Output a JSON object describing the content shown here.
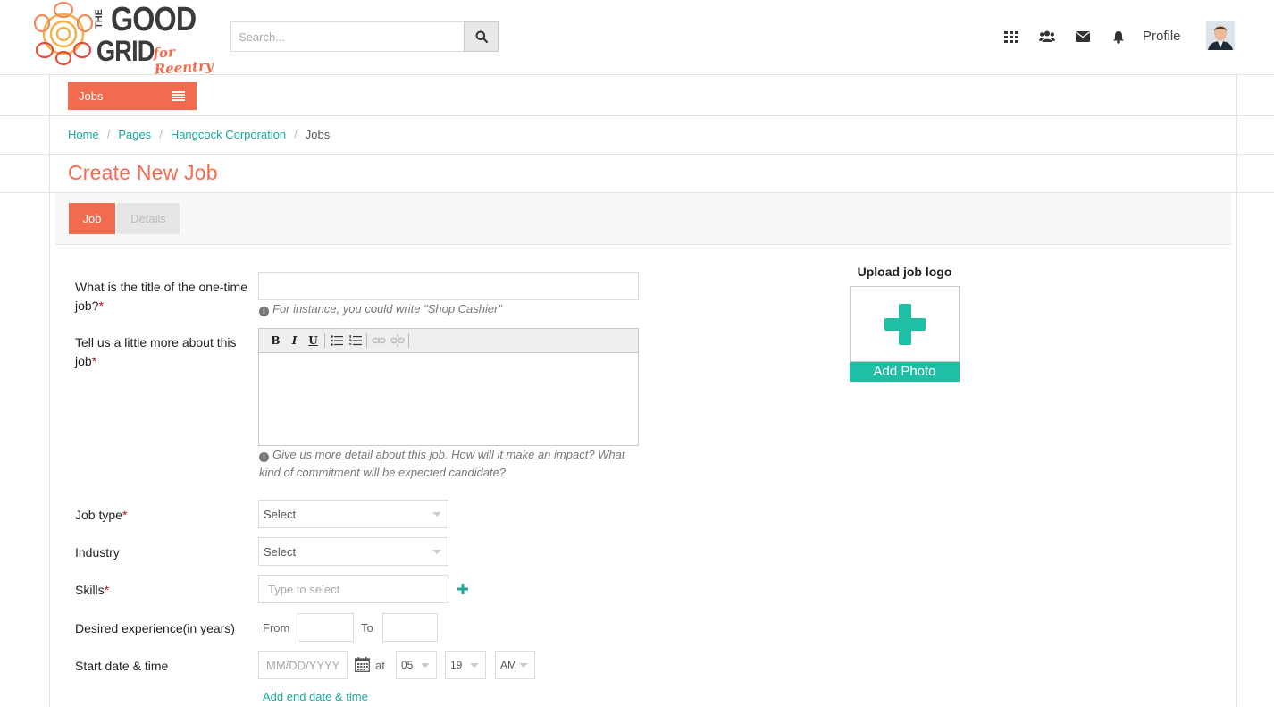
{
  "brand": {
    "the": "THE",
    "good": "GOOD",
    "grid": "GRID",
    "tagline": "for Reentry",
    "colors": {
      "accent": "#f26b50",
      "teal": "#1aa99a",
      "photo_button": "#1fbfa6",
      "logo_ring": "#f5b041"
    }
  },
  "header": {
    "search_placeholder": "Search...",
    "search_icon": "search-icon",
    "icons": [
      "apps-grid-icon",
      "users-icon",
      "envelope-icon",
      "bell-icon"
    ],
    "profile_label": "Profile"
  },
  "nav": {
    "jobs_menu_label": "Jobs"
  },
  "breadcrumb": {
    "items": [
      "Home",
      "Pages",
      "Hangcock Corporation"
    ],
    "current": "Jobs"
  },
  "page": {
    "title": "Create New Job"
  },
  "tabs": [
    {
      "label": "Job",
      "active": true
    },
    {
      "label": "Details",
      "active": false
    }
  ],
  "form": {
    "title_label": "What is the title of the one-time job?",
    "title_value": "",
    "title_hint": "For instance, you could write \"Shop Cashier\"",
    "description_label": "Tell us a little more about this job",
    "description_value": "",
    "description_hint": "Give us more detail about this job. How will it make an impact? What kind of commitment will be expected candidate?",
    "editor_toolbar": [
      "bold",
      "italic",
      "underline",
      "bullet-list",
      "numbered-list",
      "link",
      "unlink"
    ],
    "job_type_label": "Job type",
    "job_type_value": "Select",
    "industry_label": "Industry",
    "industry_value": "Select",
    "skills_label": "Skills",
    "skills_placeholder": "Type to select",
    "experience_label": "Desired experience(in years)",
    "experience_from_label": "From",
    "experience_to_label": "To",
    "experience_from_value": "",
    "experience_to_value": "",
    "start_label": "Start date & time",
    "start_date_placeholder": "MM/DD/YYYY",
    "at_label": "at",
    "start_hour": "05",
    "start_minute": "19",
    "start_ampm": "AM",
    "add_end_link": "Add end date & time"
  },
  "upload": {
    "title": "Upload job logo",
    "button_label": "Add Photo"
  }
}
